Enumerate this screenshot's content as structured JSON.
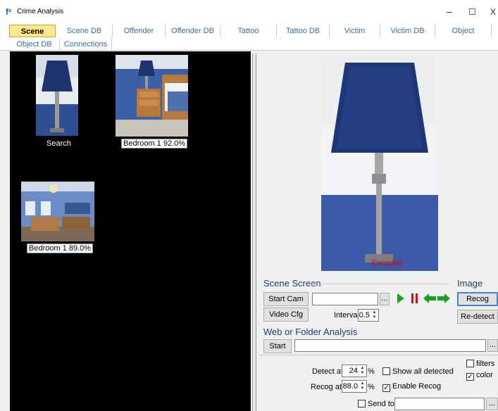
{
  "window": {
    "title": "Crime Analysis",
    "icon": "app-logo-icon",
    "minimize": "–",
    "maximize": "☐",
    "close": "X"
  },
  "tabs": [
    {
      "label": "Scene",
      "active": true
    },
    {
      "label": "Scene DB"
    },
    {
      "label": "Offender"
    },
    {
      "label": "Offender DB"
    },
    {
      "label": "Tattoo"
    },
    {
      "label": "Tattoo DB"
    },
    {
      "label": "Victim"
    },
    {
      "label": "Victim DB"
    },
    {
      "label": "Object"
    },
    {
      "label": "Object DB"
    },
    {
      "label": "Connections"
    }
  ],
  "thumbnails": [
    {
      "caption": "Search"
    },
    {
      "caption": "Bedroom 1  92.0%"
    },
    {
      "caption": "Bedroom 1  89.0%"
    }
  ],
  "preview": {
    "overlay_label": "Encoded"
  },
  "scene_screen": {
    "title": "Scene Screen",
    "start_cam": "Start Cam",
    "video_cfg": "Video Cfg",
    "source_value": "",
    "browse": "...",
    "interval_label": "Interval",
    "interval_value": "0.5"
  },
  "image_panel": {
    "title": "Image",
    "recog": "Recog",
    "redetect": "Re-detect"
  },
  "web_folder": {
    "title": "Web or Folder Analysis",
    "start": "Start",
    "path_value": "",
    "browse": "..."
  },
  "options": {
    "detect_label": "Detect at",
    "detect_value": "24",
    "detect_unit": "%",
    "recog_label": "Recog at",
    "recog_value": "88.0",
    "recog_unit": "%",
    "show_all_detected": {
      "label": "Show all detected",
      "checked": false
    },
    "enable_recog": {
      "label": "Enable Recog",
      "checked": true
    },
    "filters": {
      "label": "filters",
      "checked": false
    },
    "color": {
      "label": "color",
      "checked": true
    },
    "send_to": {
      "label": "Send to",
      "checked": false,
      "value": ""
    },
    "send_browse": "..."
  },
  "colors": {
    "active_tab": "#ffe98c",
    "tab_text": "#3a6ea5",
    "section_title": "#1f3b73",
    "encoded_label": "#e00000",
    "play": "#1aa01a",
    "pause": "#d01010",
    "arrows": "#1aa01a"
  }
}
